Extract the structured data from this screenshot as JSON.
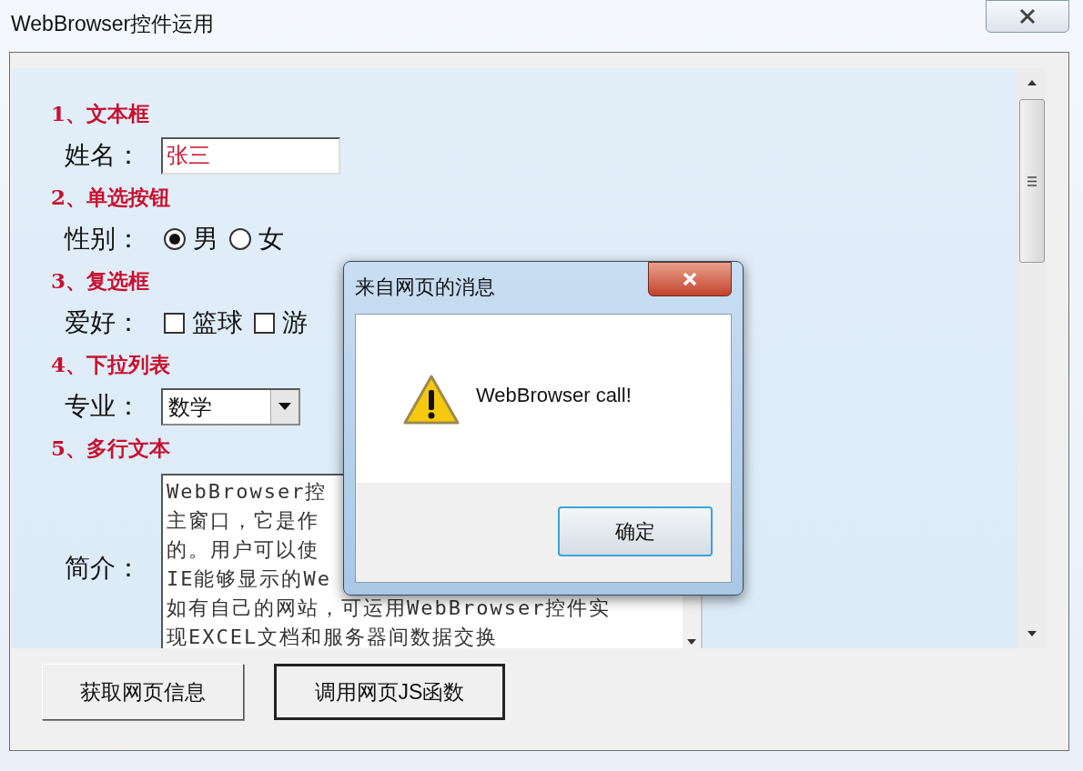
{
  "window": {
    "title": "WebBrowser控件运用"
  },
  "form": {
    "sections": [
      {
        "kind": "text",
        "heading": "1、文本框",
        "label": "姓名：",
        "value": "张三"
      },
      {
        "kind": "radio",
        "heading": "2、单选按钮",
        "label": "性别：",
        "options": [
          {
            "label": "男",
            "selected": true
          },
          {
            "label": "女",
            "selected": false
          }
        ]
      },
      {
        "kind": "checkbox",
        "heading": "3、复选框",
        "label": "爱好：",
        "options": [
          {
            "label": "篮球",
            "checked": false
          },
          {
            "label": "游",
            "checked": false
          }
        ]
      },
      {
        "kind": "select",
        "heading": "4、下拉列表",
        "label": "专业：",
        "value": "数学"
      },
      {
        "kind": "textarea",
        "heading": "5、多行文本",
        "label": "简介：",
        "lines": [
          "WebBrowser控",
          "主窗口，它是作",
          "的。用户可以使",
          "IE能够显示的We",
          "如有自己的网站，可运用WebBrowser控件实",
          "现EXCEL文档和服务器间数据交换"
        ]
      }
    ]
  },
  "buttons": [
    {
      "label": "获取网页信息",
      "focused": false
    },
    {
      "label": "调用网页JS函数",
      "focused": true
    }
  ],
  "dialog": {
    "title": "来自网页的消息",
    "message": "WebBrowser call!",
    "ok": "确定"
  }
}
